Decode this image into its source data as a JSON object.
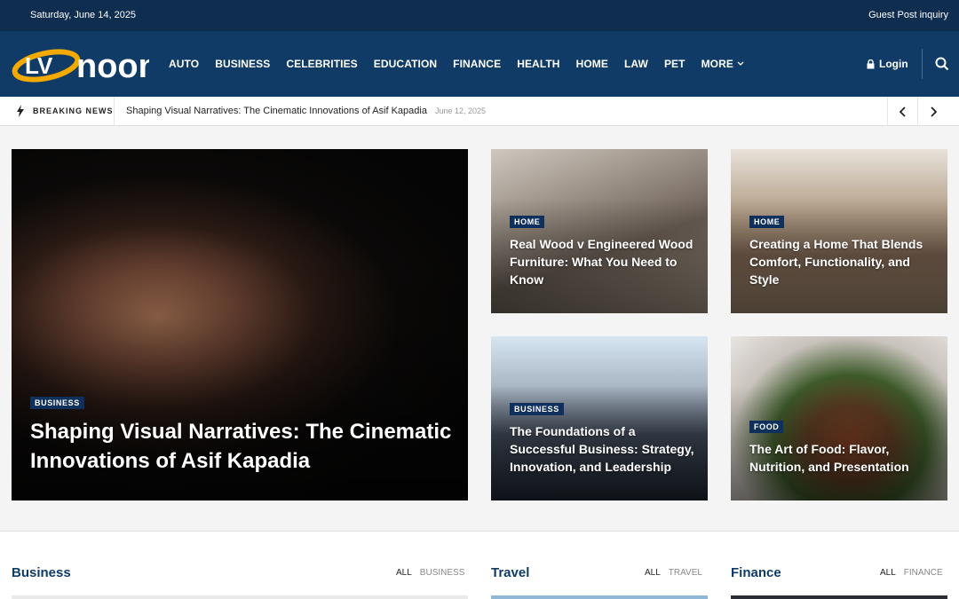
{
  "topbar": {
    "date": "Saturday, June 14, 2025",
    "guest_link": "Guest Post inquiry"
  },
  "brand": {
    "logo_text_1": "LV",
    "logo_text_2": "noon",
    "primary": "#0f3b66",
    "accent": "#f2a900"
  },
  "nav": {
    "items": [
      "AUTO",
      "BUSINESS",
      "CELEBRITIES",
      "EDUCATION",
      "FINANCE",
      "HEALTH",
      "HOME",
      "LAW",
      "PET"
    ],
    "more_label": "MORE",
    "login_label": "Login"
  },
  "ticker": {
    "label": "BREAKING NEWS",
    "headline": "Shaping Visual Narratives: The Cinematic Innovations of Asif Kapadia",
    "date": "June 12, 2025"
  },
  "featured": {
    "main": {
      "category": "BUSINESS",
      "title": "Shaping Visual Narratives: The Cinematic Innovations of Asif Kapadia"
    },
    "cards": [
      {
        "category": "HOME",
        "title": "Real Wood v Engineered Wood Furniture: What You Need to Know"
      },
      {
        "category": "HOME",
        "title": "Creating a Home That Blends Comfort, Functionality, and Style"
      },
      {
        "category": "BUSINESS",
        "title": "The Foundations of a Successful Business: Strategy, Innovation, and Leadership"
      },
      {
        "category": "FOOD",
        "title": "The Art of Food: Flavor, Nutrition, and Presentation"
      }
    ]
  },
  "sections": [
    {
      "title": "Business",
      "all": "ALL",
      "cat": "BUSINESS"
    },
    {
      "title": "Travel",
      "all": "ALL",
      "cat": "TRAVEL"
    },
    {
      "title": "Finance",
      "all": "ALL",
      "cat": "FINANCE"
    }
  ]
}
